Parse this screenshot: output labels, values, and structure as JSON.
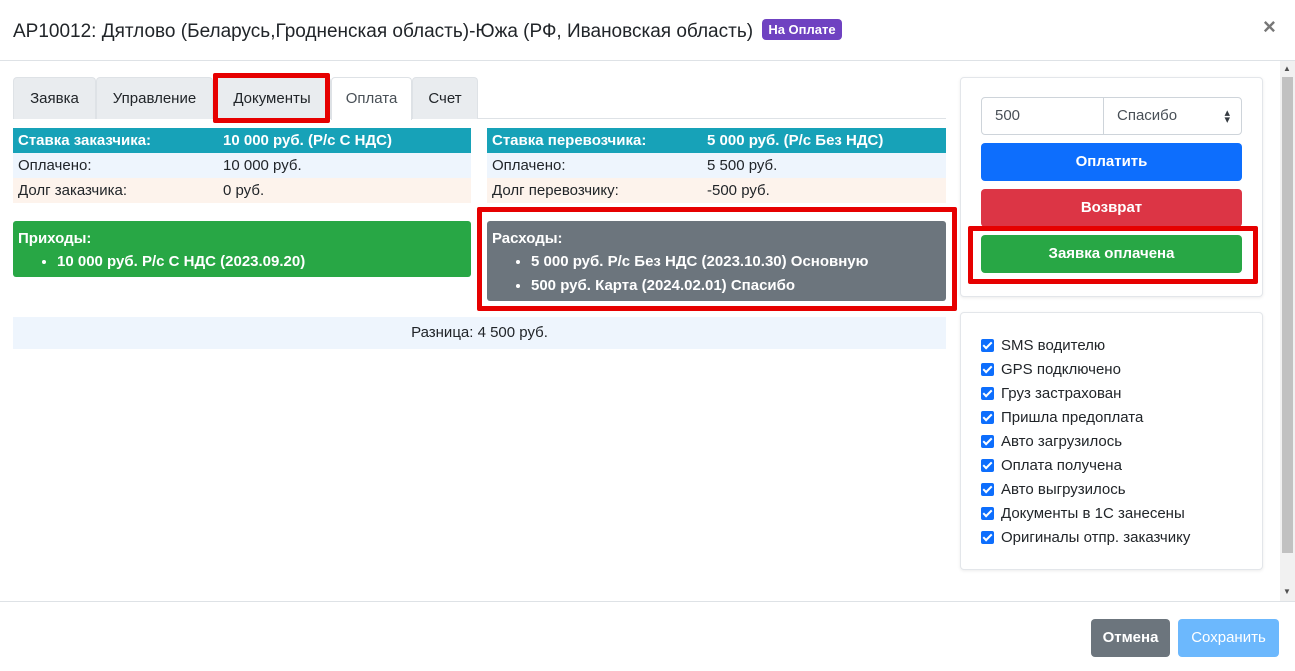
{
  "header": {
    "title": "AP10012: Дятлово (Беларусь,Гродненская область)-Южа (РФ, Ивановская область)",
    "status_badge": "На Оплате",
    "close_symbol": "×"
  },
  "tabs": [
    {
      "label": "Заявка",
      "active": false
    },
    {
      "label": "Управление",
      "active": false
    },
    {
      "label": "Документы",
      "active": false,
      "highlighted": true
    },
    {
      "label": "Оплата",
      "active": true
    },
    {
      "label": "Счет",
      "active": false
    }
  ],
  "customer": {
    "rate_label": "Ставка заказчика:",
    "rate_value": "10 000 руб. (Р/с С НДС)",
    "paid_label": "Оплачено:",
    "paid_value": "10 000 руб.",
    "debt_label": "Долг заказчика:",
    "debt_value": "0 руб."
  },
  "carrier": {
    "rate_label": "Ставка перевозчика:",
    "rate_value": "5 000 руб. (Р/с Без НДС)",
    "paid_label": "Оплачено:",
    "paid_value": "5 500 руб.",
    "debt_label": "Долг перевозчику:",
    "debt_value": "-500 руб."
  },
  "income": {
    "title": "Приходы:",
    "items": [
      "10 000 руб. Р/с С НДС (2023.09.20)"
    ]
  },
  "expenses": {
    "title": "Расходы:",
    "items": [
      "5 000 руб. Р/с Без НДС (2023.10.30) Основную",
      "500 руб. Карта (2024.02.01) Спасибо"
    ]
  },
  "difference": "Разница: 4 500 руб.",
  "payment": {
    "amount_value": "500",
    "method_selected": "Спасибо",
    "pay_label": "Оплатить",
    "refund_label": "Возврат",
    "paid_label": "Заявка оплачена"
  },
  "checklist": [
    {
      "label": "SMS водителю",
      "checked": true
    },
    {
      "label": "GPS подключено",
      "checked": true
    },
    {
      "label": "Груз застрахован",
      "checked": true
    },
    {
      "label": "Пришла предоплата",
      "checked": true
    },
    {
      "label": "Авто загрузилось",
      "checked": true
    },
    {
      "label": "Оплата получена",
      "checked": true
    },
    {
      "label": "Авто выгрузилось",
      "checked": true
    },
    {
      "label": "Документы в 1С занесены",
      "checked": true
    },
    {
      "label": "Оригиналы отпр. заказчику",
      "checked": true
    }
  ],
  "footer": {
    "cancel_label": "Отмена",
    "save_label": "Сохранить"
  },
  "colors": {
    "info_header": "#17a2b8",
    "income_green": "#28a745",
    "expense_gray": "#6c757d",
    "pay_blue": "#0d6efd",
    "refund_red": "#dc3545",
    "highlight_red": "#e60000",
    "badge_purple": "#6f42c1",
    "save_disabled": "#6cb8fd"
  }
}
